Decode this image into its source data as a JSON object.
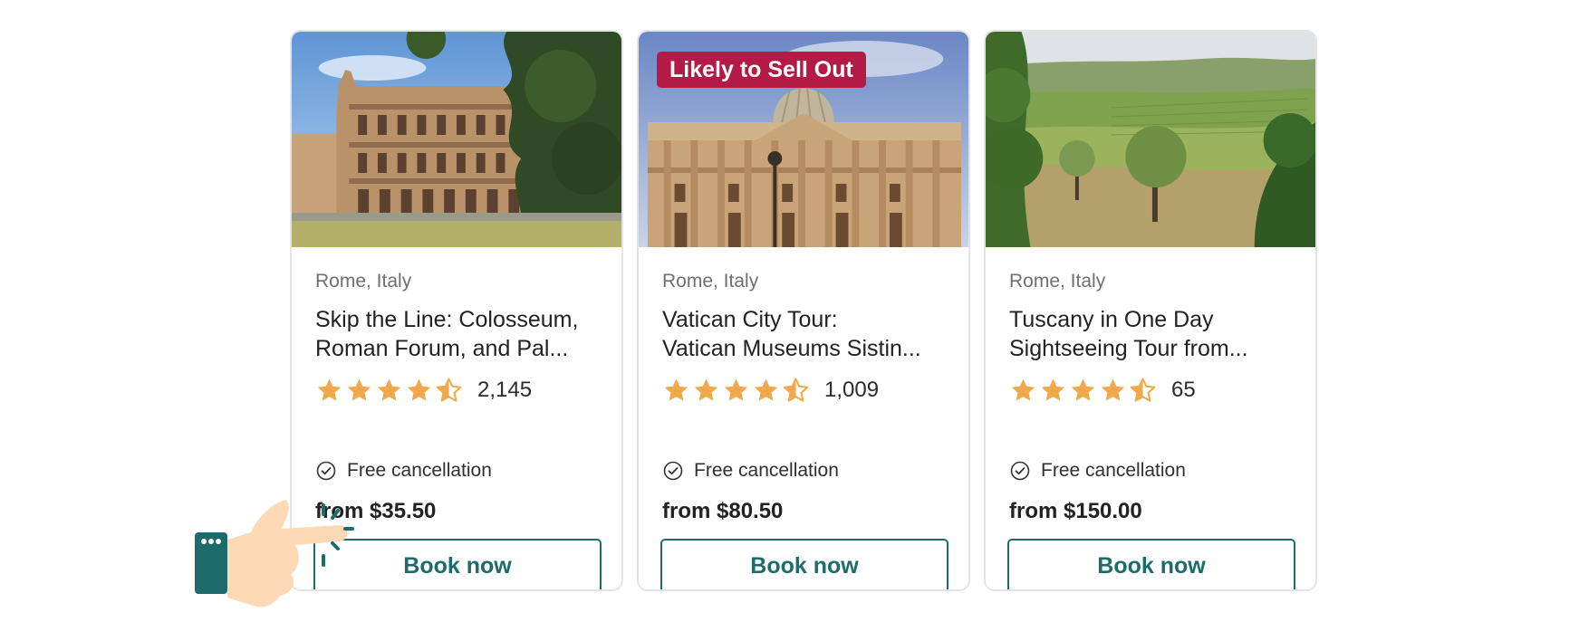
{
  "cards": [
    {
      "badge": "",
      "location": "Rome, Italy",
      "title_line1": "Skip the Line: Colosseum,",
      "title_line2": "Roman Forum, and Pal...",
      "rating": 4.5,
      "reviews": "2,145",
      "cancellation": "Free cancellation",
      "price": "from $35.50",
      "button": "Book now",
      "image": "colosseum-photo"
    },
    {
      "badge": "Likely to Sell Out",
      "location": "Rome, Italy",
      "title_line1": "Vatican City Tour:",
      "title_line2": "Vatican Museums Sistin...",
      "rating": 4.5,
      "reviews": "1,009",
      "cancellation": "Free cancellation",
      "price": "from $80.50",
      "button": "Book now",
      "image": "st-peters-basilica-photo"
    },
    {
      "badge": "",
      "location": "Rome, Italy",
      "title_line1": "Tuscany in One Day",
      "title_line2": "Sightseeing Tour from...",
      "rating": 4.5,
      "reviews": "65",
      "cancellation": "Free cancellation",
      "price": "from $150.00",
      "button": "Book now",
      "image": "tuscany-countryside-photo"
    }
  ],
  "colors": {
    "star": "#f0a94a",
    "button_text": "#1d6b6b",
    "badge": "#b31b46",
    "location_text": "#6f6f6f"
  },
  "icons": {
    "cancellation": "check-circle-icon",
    "star": "star-icon",
    "pointer": "hand-pointer-icon"
  }
}
